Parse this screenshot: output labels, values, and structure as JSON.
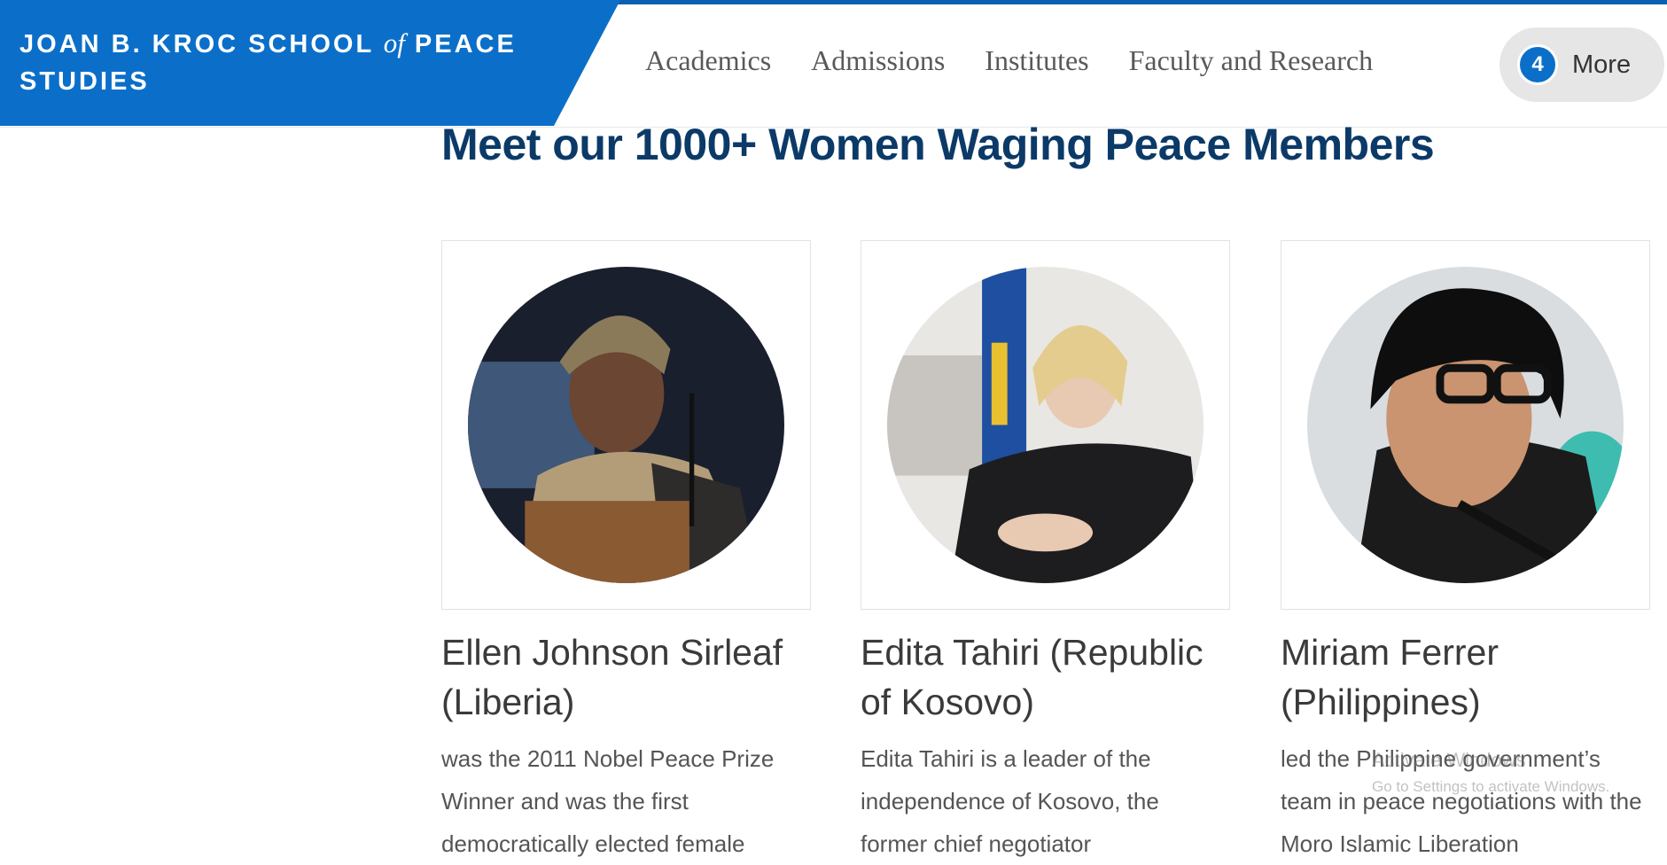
{
  "brand": {
    "line1_a": "JOAN B. KROC SCHOOL",
    "line1_of": "of",
    "line1_b": "PEACE",
    "line2": "STUDIES",
    "color": "#0b6fc9"
  },
  "nav": {
    "items": [
      "Academics",
      "Admissions",
      "Institutes",
      "Faculty and Research"
    ],
    "more": {
      "badge": "4",
      "label": "More"
    }
  },
  "main": {
    "title": "Meet our 1000+ Women Waging Peace Members",
    "title_color": "#0b3a68",
    "cards": [
      {
        "name": "Ellen Johnson Sirleaf (Liberia)",
        "bio": "was the 2011 Nobel Peace Prize Winner and was the first democratically elected female"
      },
      {
        "name": "Edita Tahiri (Republic of Kosovo)",
        "bio": "Edita Tahiri is a leader of the independence of Kosovo, the former chief negotiator"
      },
      {
        "name": "Miriam Ferrer (Philippines)",
        "bio": "led the Philippine government’s team in peace negotiations with the Moro Islamic Liberation"
      }
    ]
  },
  "watermark": {
    "title": "Activate Windows",
    "subtitle": "Go to Settings to activate Windows."
  }
}
